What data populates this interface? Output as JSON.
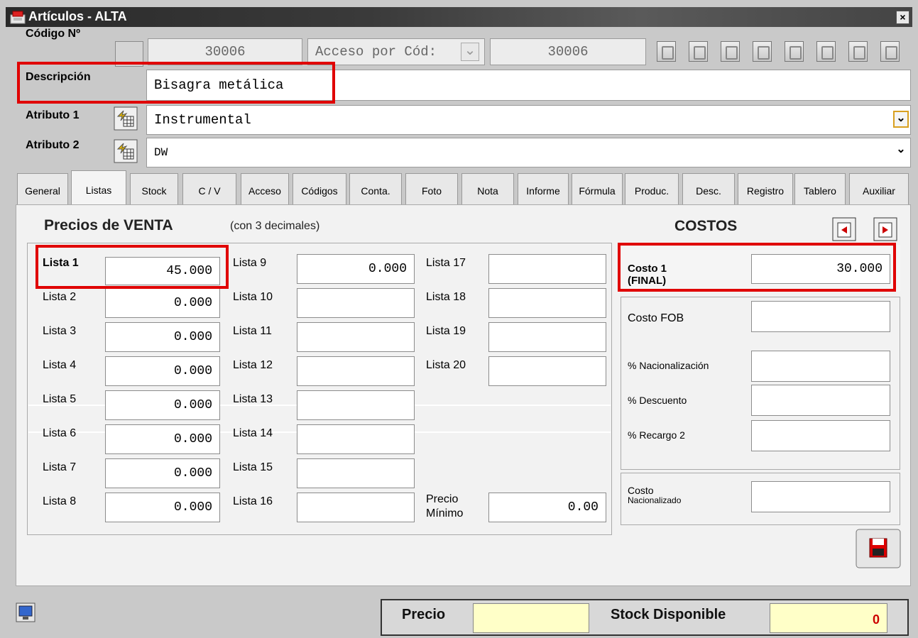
{
  "window": {
    "title": "Artículos - ALTA",
    "close_label": "×"
  },
  "header": {
    "codigo_label": "Código Nº",
    "codigo_value": "30006",
    "acceso_value": "Acceso por Cód:",
    "codigo_value2": "30006",
    "descripcion_label": "Descripción",
    "descripcion_value": "Bisagra metálica",
    "atributo1_label": "Atributo 1",
    "atributo1_value": "Instrumental",
    "atributo2_label": "Atributo 2",
    "atributo2_value": "DW",
    "dropdown_glyph": "⌄"
  },
  "tabs": [
    {
      "label": "General"
    },
    {
      "label": "Listas"
    },
    {
      "label": "Stock"
    },
    {
      "label": "C / V"
    },
    {
      "label": "Acceso"
    },
    {
      "label": "Códigos"
    },
    {
      "label": "Conta."
    },
    {
      "label": "Foto"
    },
    {
      "label": "Nota"
    },
    {
      "label": "Informe"
    },
    {
      "label": "Fórmula"
    },
    {
      "label": "Produc."
    },
    {
      "label": "Desc."
    },
    {
      "label": "Registro"
    },
    {
      "label": "Tablero"
    },
    {
      "label": "Auxiliar"
    }
  ],
  "listas": {
    "heading": "Precios de VENTA",
    "subheading": "(con 3 decimales)",
    "col1": [
      {
        "label": "Lista 1",
        "value": "45.000"
      },
      {
        "label": "Lista 2",
        "value": "0.000"
      },
      {
        "label": "Lista 3",
        "value": "0.000"
      },
      {
        "label": "Lista 4",
        "value": "0.000"
      },
      {
        "label": "Lista 5",
        "value": "0.000"
      },
      {
        "label": "Lista 6",
        "value": "0.000"
      },
      {
        "label": "Lista 7",
        "value": "0.000"
      },
      {
        "label": "Lista 8",
        "value": "0.000"
      }
    ],
    "col2": [
      {
        "label": "Lista 9",
        "value": "0.000"
      },
      {
        "label": "Lista 10",
        "value": ""
      },
      {
        "label": "Lista 11",
        "value": ""
      },
      {
        "label": "Lista 12",
        "value": ""
      },
      {
        "label": "Lista 13",
        "value": ""
      },
      {
        "label": "Lista 14",
        "value": ""
      },
      {
        "label": "Lista 15",
        "value": ""
      },
      {
        "label": "Lista 16",
        "value": ""
      }
    ],
    "col3": [
      {
        "label": "Lista 17",
        "value": ""
      },
      {
        "label": "Lista 18",
        "value": ""
      },
      {
        "label": "Lista 19",
        "value": ""
      },
      {
        "label": "Lista 20",
        "value": ""
      }
    ],
    "precio_minimo_label1": "Precio",
    "precio_minimo_label2": "Mínimo",
    "precio_minimo_value": "0.00"
  },
  "costos": {
    "heading": "COSTOS",
    "costo1_label1": "Costo 1",
    "costo1_label2": "(FINAL)",
    "costo1_value": "30.000",
    "costo_fob_label": "Costo FOB",
    "nacionalizacion_label": "% Nacionalización",
    "descuento_label": "% Descuento",
    "recargo_label": "% Recargo 2",
    "nacionalizado_label1": "Costo",
    "nacionalizado_label2": "Nacionalizado"
  },
  "status": {
    "precio_label": "Precio",
    "precio_value": "",
    "stock_label": "Stock Disponible",
    "stock_value": "0"
  },
  "colors": {
    "highlight_red": "#e00000",
    "status_yellow": "#ffffc8",
    "stock_red": "#cc0000"
  }
}
